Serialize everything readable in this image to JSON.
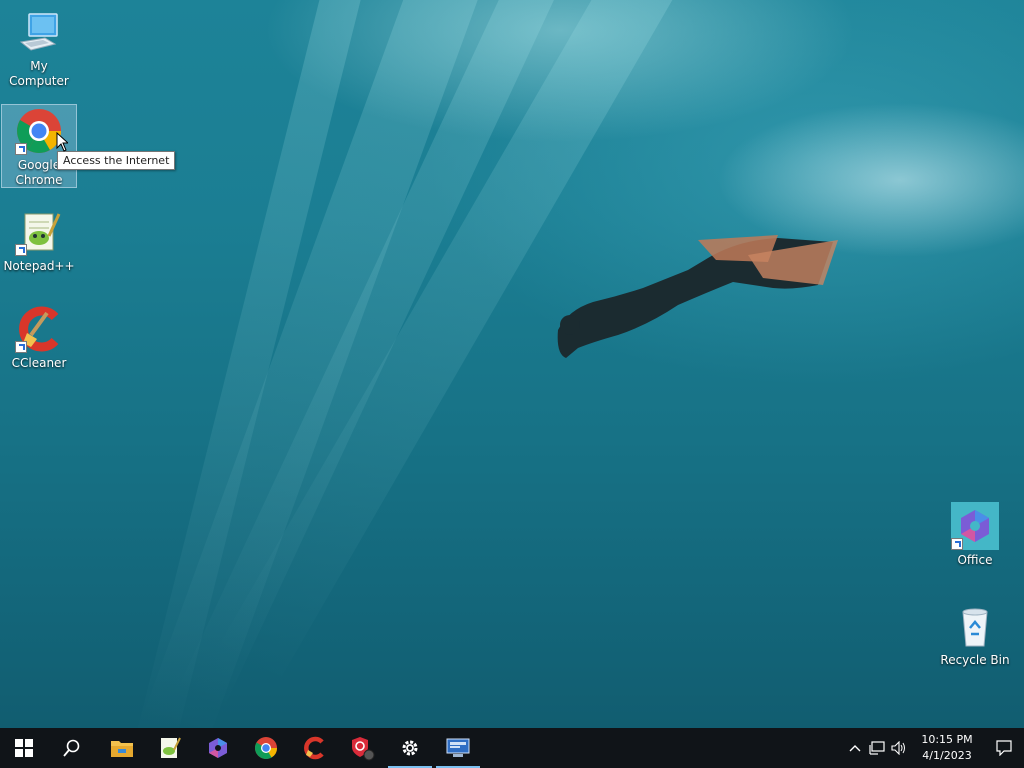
{
  "desktop": {
    "icons": [
      {
        "label": "My Computer"
      },
      {
        "label": "Google Chrome"
      },
      {
        "label": "Notepad++"
      },
      {
        "label": "CCleaner"
      },
      {
        "label": "Office"
      },
      {
        "label": "Recycle Bin"
      }
    ],
    "tooltip": "Access the Internet"
  },
  "taskbar": {
    "pinned": [
      {
        "name": "file-explorer"
      },
      {
        "name": "notepad-plus-plus"
      },
      {
        "name": "microsoft-office"
      },
      {
        "name": "google-chrome"
      },
      {
        "name": "ccleaner"
      },
      {
        "name": "vpn-shield"
      },
      {
        "name": "settings",
        "running": true
      },
      {
        "name": "remote-desktop",
        "running": true
      }
    ],
    "clock": {
      "time": "10:15 PM",
      "date": "4/1/2023"
    }
  },
  "colors": {
    "taskbar": "#101418",
    "accent": "#7cc0f0",
    "selection": "#a0c8e1"
  }
}
